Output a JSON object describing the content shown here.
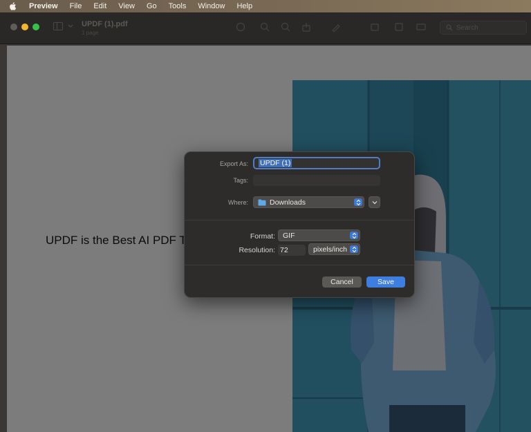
{
  "menubar": {
    "items": [
      "Preview",
      "File",
      "Edit",
      "View",
      "Go",
      "Tools",
      "Window",
      "Help"
    ]
  },
  "window": {
    "doc_title": "UPDF (1).pdf",
    "doc_subtitle": "1 page",
    "search_placeholder": "Search"
  },
  "document": {
    "text": "UPDF is the Best AI PDF T"
  },
  "dialog": {
    "export_as_label": "Export As:",
    "export_as_value": "UPDF (1)",
    "tags_label": "Tags:",
    "where_label": "Where:",
    "where_value": "Downloads",
    "format_label": "Format:",
    "format_value": "GIF",
    "resolution_label": "Resolution:",
    "resolution_value": "72",
    "resolution_unit": "pixels/inch",
    "cancel_label": "Cancel",
    "save_label": "Save"
  },
  "colors": {
    "accent": "#3d7ee0",
    "page_background": "#7c7c7c",
    "photo_tint": "#1f4a5a"
  }
}
